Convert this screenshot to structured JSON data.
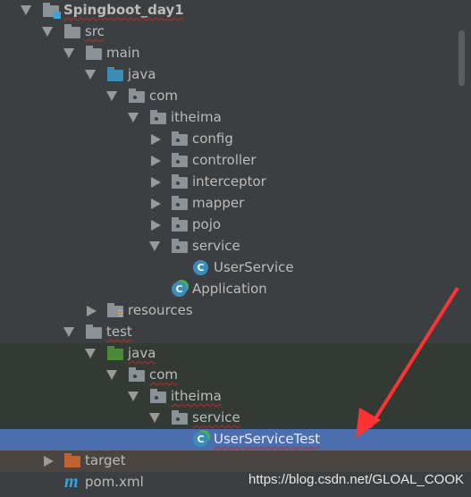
{
  "tree": [
    {
      "label": "Spingboot_day1",
      "level": 0,
      "arrow": "down",
      "icon": "module-folder",
      "squig": true,
      "bold": true
    },
    {
      "label": "src",
      "level": 1,
      "arrow": "down",
      "icon": "folder",
      "squig": true
    },
    {
      "label": "main",
      "level": 2,
      "arrow": "down",
      "icon": "folder"
    },
    {
      "label": "java",
      "level": 3,
      "arrow": "down",
      "icon": "source-folder"
    },
    {
      "label": "com",
      "level": 4,
      "arrow": "down",
      "icon": "package"
    },
    {
      "label": "itheima",
      "level": 5,
      "arrow": "down",
      "icon": "package"
    },
    {
      "label": "config",
      "level": 6,
      "arrow": "right",
      "icon": "package"
    },
    {
      "label": "controller",
      "level": 6,
      "arrow": "right",
      "icon": "package"
    },
    {
      "label": "interceptor",
      "level": 6,
      "arrow": "right",
      "icon": "package"
    },
    {
      "label": "mapper",
      "level": 6,
      "arrow": "right",
      "icon": "package"
    },
    {
      "label": "pojo",
      "level": 6,
      "arrow": "right",
      "icon": "package"
    },
    {
      "label": "service",
      "level": 6,
      "arrow": "down",
      "icon": "package"
    },
    {
      "label": "UserService",
      "level": 7,
      "arrow": "none",
      "icon": "class"
    },
    {
      "label": "Application",
      "level": 6,
      "arrow": "none",
      "icon": "spring-boot-class"
    },
    {
      "label": "resources",
      "level": 3,
      "arrow": "right",
      "icon": "resources-folder"
    },
    {
      "label": "test",
      "level": 2,
      "arrow": "down",
      "icon": "folder",
      "squig": true
    },
    {
      "label": "java",
      "level": 3,
      "arrow": "down",
      "icon": "test-folder",
      "squig": true,
      "bg": "test"
    },
    {
      "label": "com",
      "level": 4,
      "arrow": "down",
      "icon": "package",
      "squig": true,
      "bg": "test"
    },
    {
      "label": "itheima",
      "level": 5,
      "arrow": "down",
      "icon": "package",
      "squig": true,
      "bg": "test"
    },
    {
      "label": "service",
      "level": 6,
      "arrow": "down",
      "icon": "package",
      "squig": true,
      "bg": "test"
    },
    {
      "label": "UserServiceTest",
      "level": 7,
      "arrow": "none",
      "icon": "test-class",
      "squig": true,
      "bg": "sel"
    },
    {
      "label": "target",
      "level": 1,
      "arrow": "right",
      "icon": "excluded-folder",
      "bg": "excl"
    },
    {
      "label": "pom.xml",
      "level": 1,
      "arrow": "none",
      "icon": "maven"
    }
  ],
  "watermark": "https://blog.csdn.net/GLOAL_COOK",
  "colors": {
    "background": "#3c3f41",
    "selection": "#4b6eaf",
    "test_area": "#323a33",
    "annotation_arrow": "#ff3333"
  }
}
